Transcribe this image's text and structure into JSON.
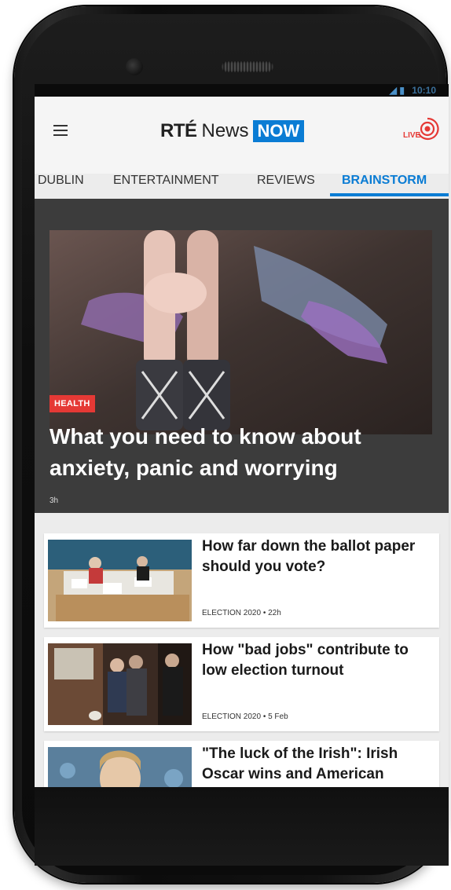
{
  "status": {
    "signal": "◢ ▮",
    "time": "10:10"
  },
  "appbar": {
    "logo_rte": "RTÉ",
    "logo_news": "News",
    "logo_now": "NOW",
    "live_label": "LIVE"
  },
  "tabs": [
    {
      "label": "DUBLIN"
    },
    {
      "label": "ENTERTAINMENT"
    },
    {
      "label": "REVIEWS"
    },
    {
      "label": "BRAINSTORM"
    }
  ],
  "hero": {
    "tag": "HEALTH",
    "title": "What you need to know about anxiety, panic and worrying",
    "time": "3h"
  },
  "cards": [
    {
      "title": "How far down the ballot paper should you vote?",
      "meta": "ELECTION 2020 • 22h"
    },
    {
      "title": "How \"bad jobs\" contribute to low election turnout",
      "meta": "ELECTION 2020 • 5 Feb"
    },
    {
      "title": "\"The luck of the Irish\": Irish Oscar wins and American",
      "meta": ""
    }
  ],
  "colors": {
    "accent": "#0a7cd4",
    "tag_red": "#e53935",
    "hero_bg": "#3c3c3c"
  }
}
